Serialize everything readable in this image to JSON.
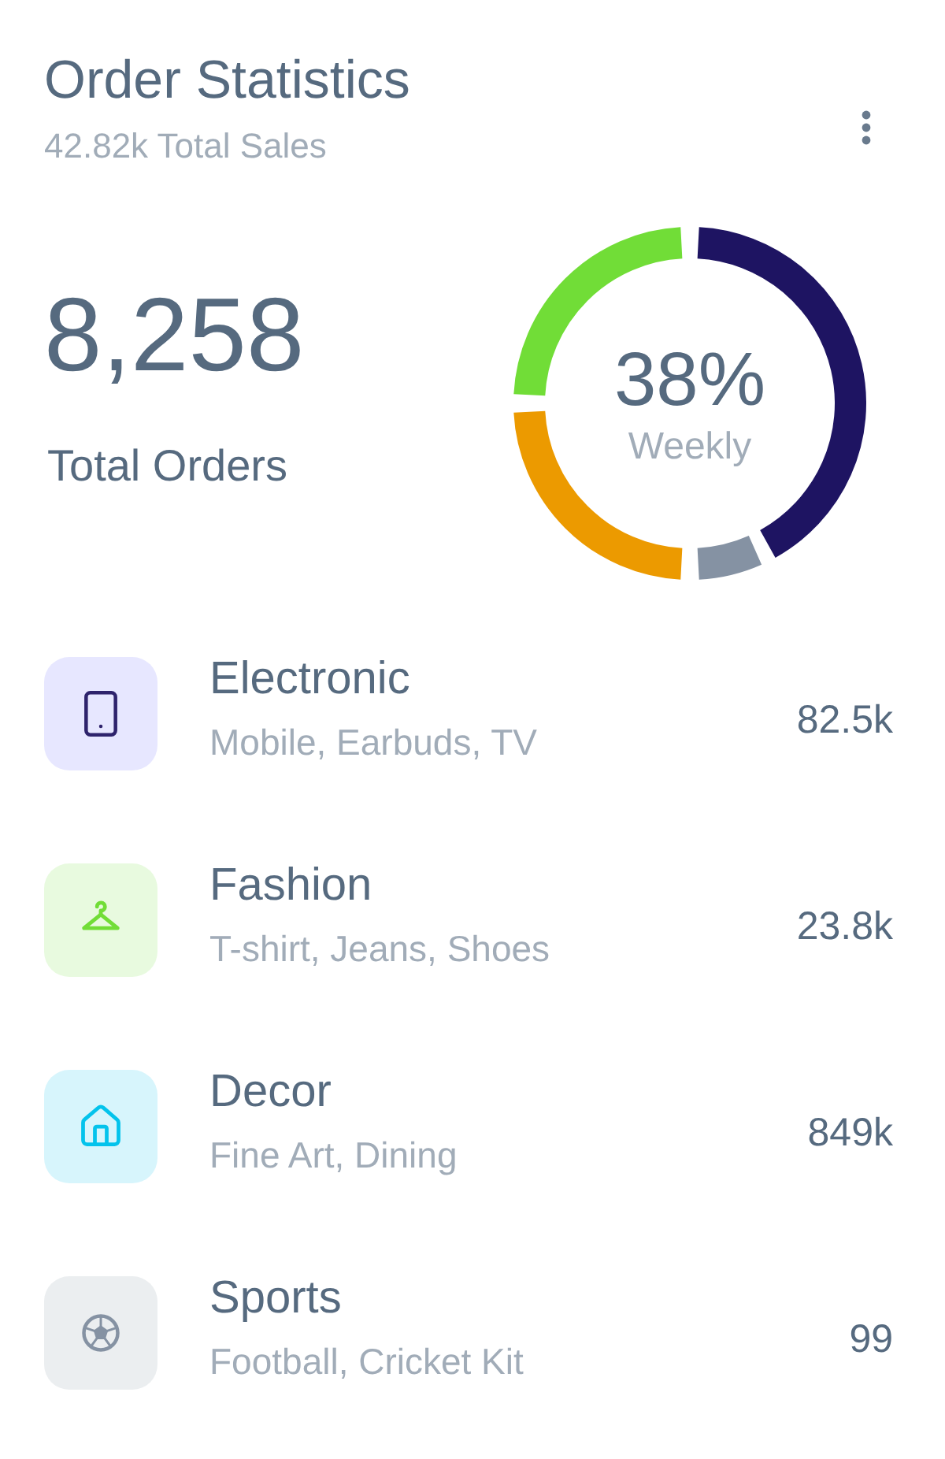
{
  "header": {
    "title": "Order Statistics",
    "subtitle": "42.82k Total Sales"
  },
  "summary": {
    "total": "8,258",
    "label": "Total Orders"
  },
  "donut": {
    "center_value": "38%",
    "center_label": "Weekly"
  },
  "categories": [
    {
      "name": "Electronic",
      "items": "Mobile, Earbuds, TV",
      "value": "82.5k",
      "color": "#2e236c"
    },
    {
      "name": "Fashion",
      "items": "T-shirt, Jeans, Shoes",
      "value": "23.8k",
      "color": "#71dd37"
    },
    {
      "name": "Decor",
      "items": "Fine Art, Dining",
      "value": "849k",
      "color": "#03c3ec"
    },
    {
      "name": "Sports",
      "items": "Football, Cricket Kit",
      "value": "99",
      "color": "#8592a3"
    }
  ]
}
